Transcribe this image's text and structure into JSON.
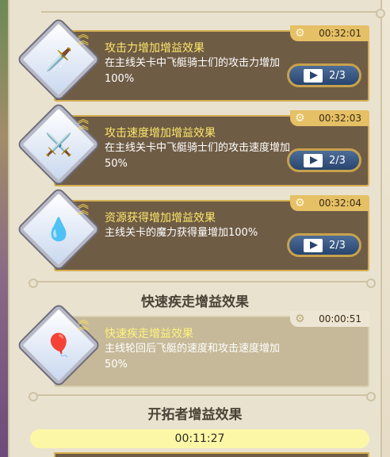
{
  "buffs": [
    {
      "title": "攻击力增加增益效果",
      "desc": "在主线关卡中飞艇骑士们的攻击力增加 100%",
      "timer": "00:32:01",
      "ad_count": "2/3",
      "icon": "sword-icon"
    },
    {
      "title": "攻击速度增加增益效果",
      "desc": "在主线关卡中飞艇骑士们的攻击速度增加 50%",
      "timer": "00:32:03",
      "ad_count": "2/3",
      "icon": "twin-swords-icon"
    },
    {
      "title": "资源获得增加增益效果",
      "desc": "主线关卡的魔力获得量增加100%",
      "timer": "00:32:04",
      "ad_count": "2/3",
      "icon": "mana-orb-icon"
    }
  ],
  "quick_section": {
    "title": "快速疾走增益效果",
    "buff": {
      "title": "快速疾走增益效果",
      "desc": "主线轮回后飞艇的速度和攻击速度增加50%",
      "timer": "00:00:51",
      "icon": "airship-icon"
    }
  },
  "pioneer_section": {
    "title": "开拓者增益效果",
    "timer": "00:11:27"
  },
  "colors": {
    "card_bg": "#6f5c45",
    "card_border": "#d4ae52",
    "title_yellow": "#fde86a",
    "timer_tab": "#e5c065",
    "ad_button": "#27456f",
    "pioneer_bar": "#fbf7a7"
  }
}
